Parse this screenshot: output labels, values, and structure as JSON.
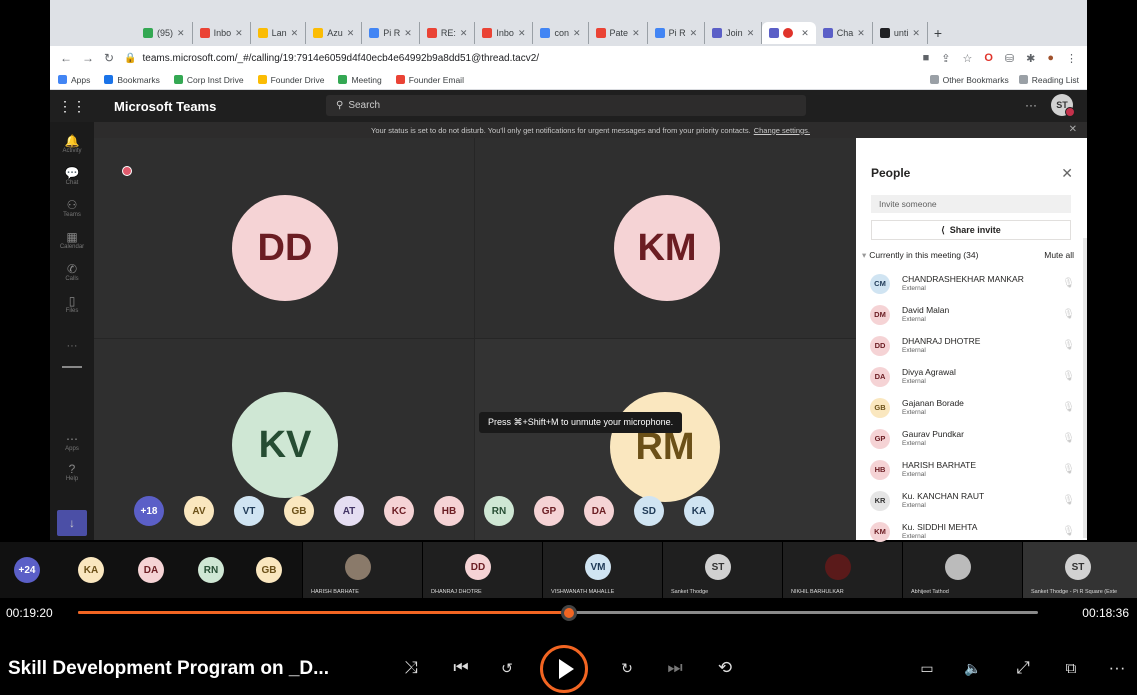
{
  "browser": {
    "tabs": [
      {
        "label": "(95)",
        "color": "#34a853"
      },
      {
        "label": "Inbo",
        "color": "#ea4335"
      },
      {
        "label": "Lan",
        "color": "#fbbc04"
      },
      {
        "label": "Azu",
        "color": "#fbbc04"
      },
      {
        "label": "Pi R",
        "color": "#4285f4"
      },
      {
        "label": "RE:",
        "color": "#ea4335"
      },
      {
        "label": "Inbo",
        "color": "#ea4335"
      },
      {
        "label": "con",
        "color": "#4285f4"
      },
      {
        "label": "Pate",
        "color": "#ea4335"
      },
      {
        "label": "Pi R",
        "color": "#4285f4"
      },
      {
        "label": "Join",
        "color": "#5b5fc7"
      },
      {
        "label": "",
        "color": "#5b5fc7"
      },
      {
        "label": "Cha",
        "color": "#5b5fc7"
      },
      {
        "label": "unti",
        "color": "#202124"
      }
    ],
    "url": "teams.microsoft.com/_#/calling/19:7914e6059d4f40ecb4e64992b9a8dd51@thread.tacv2/",
    "bookmarks": [
      {
        "label": "Apps",
        "color": "#4285f4"
      },
      {
        "label": "Bookmarks",
        "color": "#1a73e8"
      },
      {
        "label": "Corp Inst Drive",
        "color": "#34a853"
      },
      {
        "label": "Founder Drive",
        "color": "#fbbc04"
      },
      {
        "label": "Meeting",
        "color": "#34a853"
      },
      {
        "label": "Founder Email",
        "color": "#ea4335"
      }
    ],
    "other_bookmarks": "Other Bookmarks",
    "reading_list": "Reading List"
  },
  "teams": {
    "title": "Microsoft Teams",
    "search_placeholder": "Search",
    "me_initials": "ST",
    "rail": [
      "Activity",
      "Chat",
      "Teams",
      "Calendar",
      "Calls",
      "Files",
      "Apps",
      "Help"
    ],
    "dnd_text": "Your status is set to do not disturb. You'll only get notifications for urgent messages and from your priority contacts.",
    "dnd_link": "Change settings."
  },
  "stage": {
    "tiles": [
      {
        "initials": "DD",
        "bg": "#f5d3d5",
        "fg": "#6b1d23"
      },
      {
        "initials": "KM",
        "bg": "#f5d3d5",
        "fg": "#6b1d23"
      },
      {
        "initials": "KV",
        "bg": "#cfe7d4",
        "fg": "#264d33"
      },
      {
        "initials": "RM",
        "bg": "#fae7bf",
        "fg": "#6b5018"
      }
    ],
    "tooltip": "Press ⌘+Shift+M to unmute your microphone.",
    "strip": [
      {
        "initials": "+18",
        "bg": "#5b5fc7",
        "fg": "#fff"
      },
      {
        "initials": "AV",
        "bg": "#fae7bf",
        "fg": "#6b5018"
      },
      {
        "initials": "VT",
        "bg": "#d0e4f2",
        "fg": "#1f3a57"
      },
      {
        "initials": "GB",
        "bg": "#fae7bf",
        "fg": "#6b5018"
      },
      {
        "initials": "AT",
        "bg": "#e5def2",
        "fg": "#433566"
      },
      {
        "initials": "KC",
        "bg": "#f5d3d5",
        "fg": "#6b1d23"
      },
      {
        "initials": "HB",
        "bg": "#f5d3d5",
        "fg": "#6b1d23"
      },
      {
        "initials": "RN",
        "bg": "#cfe7d4",
        "fg": "#264d33"
      },
      {
        "initials": "GP",
        "bg": "#f5d3d5",
        "fg": "#6b1d23"
      },
      {
        "initials": "DA",
        "bg": "#f5d3d5",
        "fg": "#6b1d23"
      },
      {
        "initials": "SD",
        "bg": "#d0e4f2",
        "fg": "#1f3a57"
      },
      {
        "initials": "KA",
        "bg": "#d0e4f2",
        "fg": "#1f3a57"
      }
    ]
  },
  "people": {
    "title": "People",
    "invite_placeholder": "Invite someone",
    "share_label": "Share invite",
    "current_label": "Currently in this meeting (34)",
    "mute_all": "Mute all",
    "list": [
      {
        "initials": "CM",
        "name": "CHANDRASHEKHAR MANKAR",
        "sub": "External",
        "bg": "#d0e4f2",
        "fg": "#1f3a57"
      },
      {
        "initials": "DM",
        "name": "David Malan",
        "sub": "External",
        "bg": "#f5d3d5",
        "fg": "#6b1d23"
      },
      {
        "initials": "DD",
        "name": "DHANRAJ DHOTRE",
        "sub": "External",
        "bg": "#f5d3d5",
        "fg": "#6b1d23"
      },
      {
        "initials": "DA",
        "name": "Divya Agrawal",
        "sub": "External",
        "bg": "#f5d3d5",
        "fg": "#6b1d23"
      },
      {
        "initials": "GB",
        "name": "Gajanan Borade",
        "sub": "External",
        "bg": "#fae7bf",
        "fg": "#6b5018"
      },
      {
        "initials": "GP",
        "name": "Gaurav Pundkar",
        "sub": "External",
        "bg": "#f5d3d5",
        "fg": "#6b1d23"
      },
      {
        "initials": "HB",
        "name": "HARISH BARHATE",
        "sub": "External",
        "bg": "#f5d3d5",
        "fg": "#6b1d23"
      },
      {
        "initials": "KR",
        "name": "Ku. KANCHAN RAUT",
        "sub": "External",
        "bg": "#e5e5e5",
        "fg": "#333"
      },
      {
        "initials": "KM",
        "name": "Ku. SIDDHI MEHTA",
        "sub": "External",
        "bg": "#f5d3d5",
        "fg": "#6b1d23"
      }
    ]
  },
  "pbar": {
    "more": "+24",
    "small": [
      {
        "initials": "KA",
        "bg": "#fae7bf",
        "fg": "#6b5018"
      },
      {
        "initials": "DA",
        "bg": "#f5d3d5",
        "fg": "#6b1d23"
      },
      {
        "initials": "RN",
        "bg": "#cfe7d4",
        "fg": "#264d33"
      },
      {
        "initials": "GB",
        "bg": "#fae7bf",
        "fg": "#6b5018"
      }
    ],
    "tiles": [
      {
        "initials": "",
        "name": "HARISH BARHATE",
        "photo": true,
        "bg": "#8a7a6a"
      },
      {
        "initials": "DD",
        "name": "DHANRAJ DHOTRE",
        "photo": false,
        "bg": "#f5d3d5",
        "fg": "#6b1d23"
      },
      {
        "initials": "VM",
        "name": "VISHWANATH MAHALLE",
        "photo": false,
        "bg": "#d0e4f2",
        "fg": "#1f3a57"
      },
      {
        "initials": "ST",
        "name": "Sanket Thodge",
        "photo": false,
        "bg": "#d1d1d1",
        "fg": "#333"
      },
      {
        "initials": "",
        "name": "NIKHIL BARHULKAR",
        "photo": true,
        "bg": "#5a1a1a"
      },
      {
        "initials": "",
        "name": "Abhijeet Tathod",
        "photo": true,
        "bg": "#bbbbbb"
      },
      {
        "initials": "ST",
        "name": "Sanket Thodge - Pi R Square (Exte",
        "photo": false,
        "bg": "#d1d1d1",
        "fg": "#333"
      }
    ]
  },
  "player": {
    "elapsed": "00:19:20",
    "remaining": "00:18:36",
    "progress": 0.511,
    "title": "Skill Development Program on _D...",
    "accent": "#f26522"
  }
}
